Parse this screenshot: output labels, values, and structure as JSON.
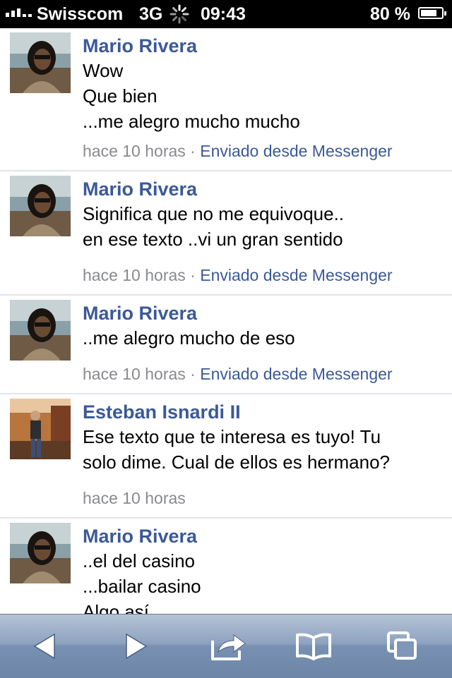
{
  "status_bar": {
    "carrier": "Swisscom",
    "network": "3G",
    "time": "09:43",
    "battery_percent_label": "80 %",
    "battery_level": 0.8
  },
  "posts": [
    {
      "author": "Mario Rivera",
      "lines": [
        "Wow",
        "Que bien",
        "...me alegro mucho mucho"
      ],
      "time": "hace 10 horas",
      "separator": "·",
      "via": "Enviado desde Messenger"
    },
    {
      "author": "Mario Rivera",
      "lines": [
        "Significa que no me equivoque..",
        "en ese texto ..vi un gran sentido"
      ],
      "time": "hace 10 horas",
      "separator": "·",
      "via": "Enviado desde Messenger"
    },
    {
      "author": "Mario Rivera",
      "lines": [
        "..me alegro mucho de eso"
      ],
      "time": "hace 10 horas",
      "separator": "·",
      "via": "Enviado desde Messenger"
    },
    {
      "author": "Esteban Isnardi II",
      "lines": [
        "Ese texto que te interesa es tuyo! Tu",
        "solo dime. Cual de ellos es hermano?"
      ],
      "time": "hace 10 horas"
    },
    {
      "author": "Mario Rivera",
      "lines": [
        "..el del casino",
        "...bailar casino",
        "Algo así"
      ]
    }
  ],
  "toolbar": {
    "icons": [
      "back-arrow-icon",
      "forward-arrow-icon",
      "share-icon",
      "bookmarks-icon",
      "tabs-icon"
    ]
  }
}
